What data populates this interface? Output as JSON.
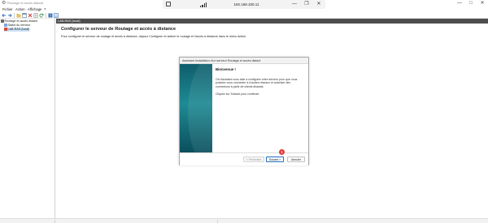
{
  "window": {
    "title": "Routage et accès distant",
    "icon": "routing-app-icon",
    "controls": {
      "minimize": "—",
      "maximize": "□",
      "close": "✕"
    }
  },
  "remote_bar": {
    "host": "192.168.100.11",
    "pin_icon": "pin-icon",
    "signal_icon": "signal-bars-icon",
    "minimize": "—",
    "restore": "❐",
    "close": "✕"
  },
  "menu": [
    "Fichier",
    "Action",
    "Affichage",
    "?"
  ],
  "toolbar": {
    "icons": [
      "back-arrow-icon",
      "forward-arrow-icon",
      "folder-up-icon",
      "console-tree-icon",
      "properties-icon",
      "delete-icon",
      "refresh-icon",
      "export-list-icon",
      "help-icon",
      "mmc-icon"
    ]
  },
  "tree": {
    "root": "Routage et accès distant",
    "items": [
      "Statut du serveur",
      "LAB-RAS (local)"
    ]
  },
  "pane": {
    "header": "LAB-RAS (local)",
    "title": "Configurer le serveur de Routage et accès à distance",
    "description": "Pour configurer le serveur de routage et accès à distance, cliquez Configurer et activer le routage et l'accès à distance dans le menu Action."
  },
  "wizard": {
    "title": "Assistant Installation d'un serveur Routage et accès distant",
    "heading": "Bienvenue !",
    "text": "Cet Assistant vous aide à configurer votre serveur pour que vous puissiez vous connecter à d'autres réseaux et autoriser des connexions à partir de clients distants.",
    "continue": "Cliquez sur Suivant pour continuer.",
    "buttons": {
      "back": "< Précédent",
      "next": "Suivant >",
      "cancel": "Annuler"
    },
    "step_marker": "1"
  },
  "colors": {
    "accent": "#2a6fbf",
    "marker": "#e03b36",
    "pane_header": "#4d4d4d",
    "wizard_panel": "#1e8a93"
  }
}
